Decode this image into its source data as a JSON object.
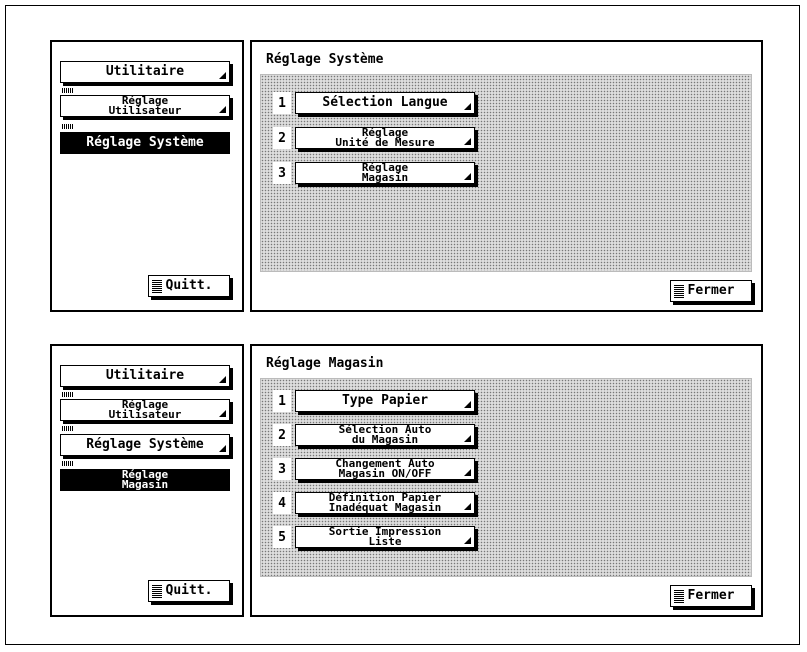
{
  "screen1": {
    "sidebar": {
      "items": [
        {
          "label": "Utilitaire",
          "active": false
        },
        {
          "label": "Réglage\nUtilisateur",
          "active": false
        },
        {
          "label": "Réglage Système",
          "active": true
        }
      ],
      "quit_label": "Quitt."
    },
    "panel": {
      "title": "Réglage Système",
      "options": [
        {
          "num": "1",
          "label": "Sélection Langue"
        },
        {
          "num": "2",
          "label": "Réglage\nUnité de Mesure"
        },
        {
          "num": "3",
          "label": "Réglage\nMagasin"
        }
      ],
      "close_label": "Fermer"
    }
  },
  "screen2": {
    "sidebar": {
      "items": [
        {
          "label": "Utilitaire",
          "active": false
        },
        {
          "label": "Réglage\nUtilisateur",
          "active": false
        },
        {
          "label": "Réglage Système",
          "active": false
        },
        {
          "label": "Réglage\nMagasin",
          "active": true
        }
      ],
      "quit_label": "Quitt."
    },
    "panel": {
      "title": "Réglage Magasin",
      "options": [
        {
          "num": "1",
          "label": "Type Papier"
        },
        {
          "num": "2",
          "label": "Sélection Auto\ndu Magasin"
        },
        {
          "num": "3",
          "label": "Changement Auto\nMagasin ON/OFF"
        },
        {
          "num": "4",
          "label": "Définition Papier\nInadéquat Magasin"
        },
        {
          "num": "5",
          "label": "Sortie Impression\nListe"
        }
      ],
      "close_label": "Fermer"
    }
  }
}
